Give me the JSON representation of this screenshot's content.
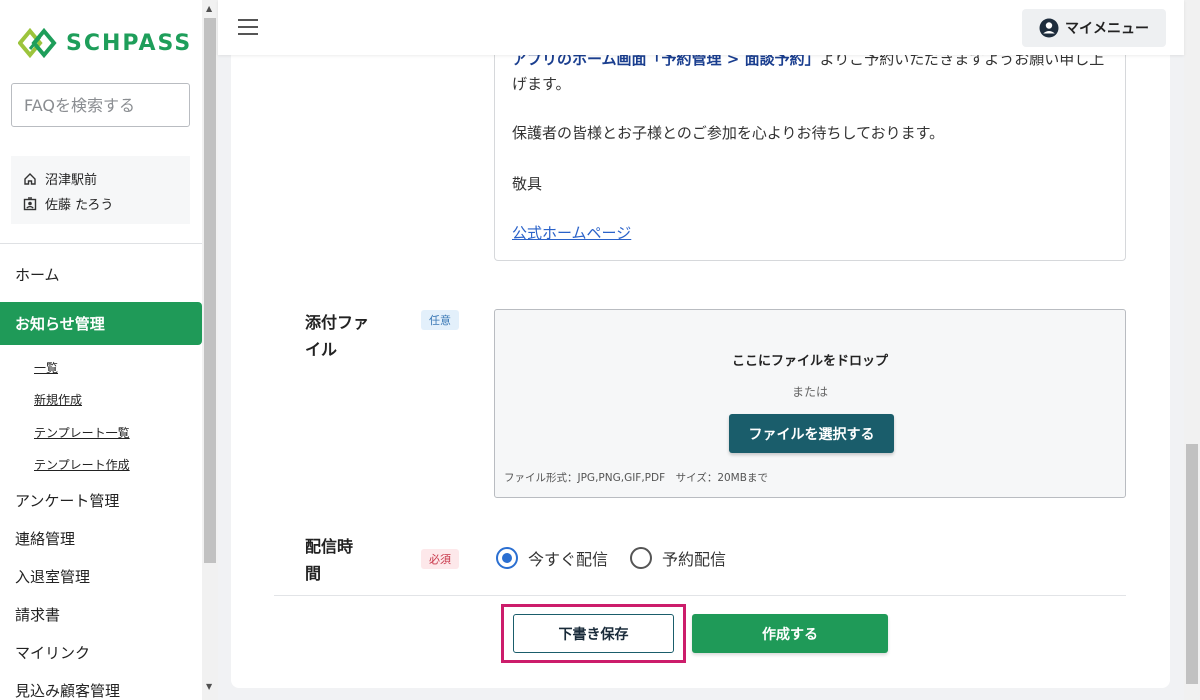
{
  "app": {
    "logo_text": "SCHPASS"
  },
  "sidebar": {
    "search_placeholder": "FAQを検索する",
    "school": "沼津駅前",
    "user": "佐藤 たろう",
    "nav": [
      {
        "label": "ホーム"
      },
      {
        "label": "お知らせ管理"
      }
    ],
    "sub_items": [
      {
        "label": "一覧"
      },
      {
        "label": "新規作成"
      },
      {
        "label": "テンプレート一覧"
      },
      {
        "label": "テンプレート作成"
      }
    ],
    "nav_after": [
      {
        "label": "アンケート管理"
      },
      {
        "label": "連絡管理"
      },
      {
        "label": "入退室管理"
      },
      {
        "label": "請求書"
      },
      {
        "label": "マイリンク"
      },
      {
        "label": "見込み顧客管理"
      }
    ]
  },
  "header": {
    "mymenu_label": "マイメニュー"
  },
  "body_text": {
    "line1_bold": "アプリのホーム画面「予約管理 > 面談予約」",
    "line1_rest": "よりご予約いただきますようお願い申し上げます。",
    "p2": "保護者の皆様とお子様とのご参加を心よりお待ちしております。",
    "p3": "敬具",
    "link": "公式ホームページ"
  },
  "attachment": {
    "label_line1": "添付ファ",
    "label_line2": "イル",
    "badge": "任意",
    "drop_title": "ここにファイルをドロップ",
    "or": "または",
    "select_button": "ファイルを選択する",
    "note": "ファイル形式：JPG,PNG,GIF,PDF　サイズ：20MBまで"
  },
  "delivery": {
    "label_line1": "配信時",
    "label_line2": "間",
    "badge": "必須",
    "options": [
      {
        "label": "今すぐ配信",
        "checked": true
      },
      {
        "label": "予約配信",
        "checked": false
      }
    ]
  },
  "actions": {
    "draft": "下書き保存",
    "create": "作成する"
  },
  "colors": {
    "brand_green": "#1f9a58",
    "teal_button": "#1a5d6b",
    "highlight": "#cc1d6b"
  }
}
